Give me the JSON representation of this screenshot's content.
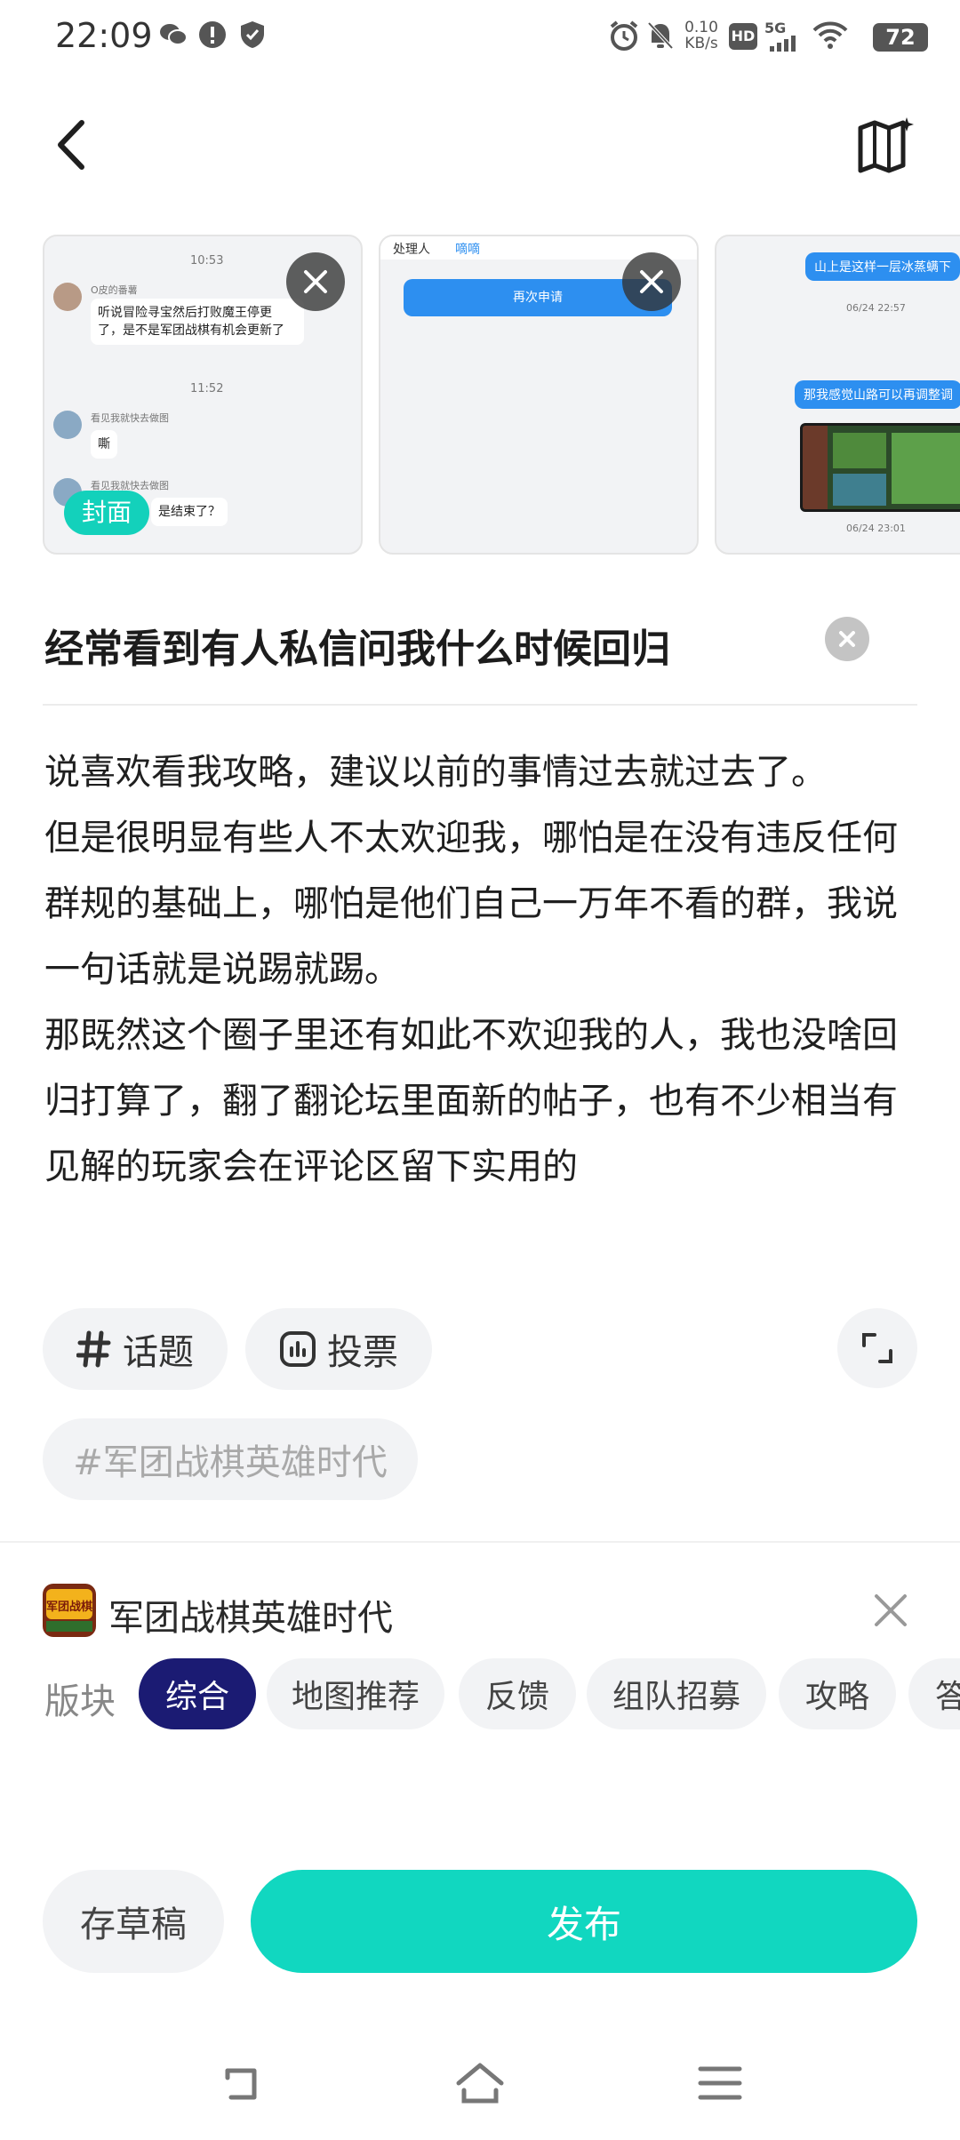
{
  "status_bar": {
    "time": "22:09",
    "net_speed": "0.10",
    "net_unit": "KB/s",
    "hd": "HD",
    "signal": "5G",
    "battery": "72"
  },
  "images": [
    {
      "is_cover": true,
      "cover_label": "封面",
      "msgs": {
        "t1": "10:53",
        "sender1": "O皮的番薯",
        "line1": "听说冒险寻宝然后打败魔王停更",
        "line2": "了，是不是军团战棋有机会更新了",
        "t2": "11:52",
        "sender2": "看见我就快去做图",
        "reply": "嘶",
        "sender3": "看见我就快去做图",
        "last": "是结束了？"
      }
    },
    {
      "is_cover": false,
      "msgs": {
        "field_label": "处理人",
        "field_value": "嘀嘀",
        "button": "再次申请"
      }
    },
    {
      "is_cover": false,
      "msgs": {
        "m1": "山上是这样一层冰蒸螨下",
        "t1": "06/24 22:57",
        "m2": "那我感觉山路可以再调整调",
        "t2": "06/24 23:01"
      }
    }
  ],
  "title": "经常看到有人私信问我什么时候回归",
  "body": [
    "说喜欢看我攻略，建议以前的事情过去就过去了。",
    "但是很明显有些人不太欢迎我，哪怕是在没有违反任何群规的基础上，哪怕是他们自己一万年不看的群，我说一句话就是说踢就踢。",
    "那既然这个圈子里还有如此不欢迎我的人，我也没啥回归打算了，翻了翻论坛里面新的帖子，也有不少相当有见解的玩家会在评论区留下实用的"
  ],
  "tools": {
    "topic": "话题",
    "vote": "投票"
  },
  "tag": "#军团战棋英雄时代",
  "game": {
    "name": "军团战棋英雄时代",
    "icon_text": "军团战棋"
  },
  "boards": {
    "label": "版块",
    "items": [
      "综合",
      "地图推荐",
      "反馈",
      "组队招募",
      "攻略",
      "答疑"
    ],
    "active_index": 0
  },
  "actions": {
    "draft": "存草稿",
    "publish": "发布"
  },
  "colors": {
    "accent": "#11d7c0",
    "active_board": "#1b1b73",
    "cover_badge": "#13d1bb"
  }
}
